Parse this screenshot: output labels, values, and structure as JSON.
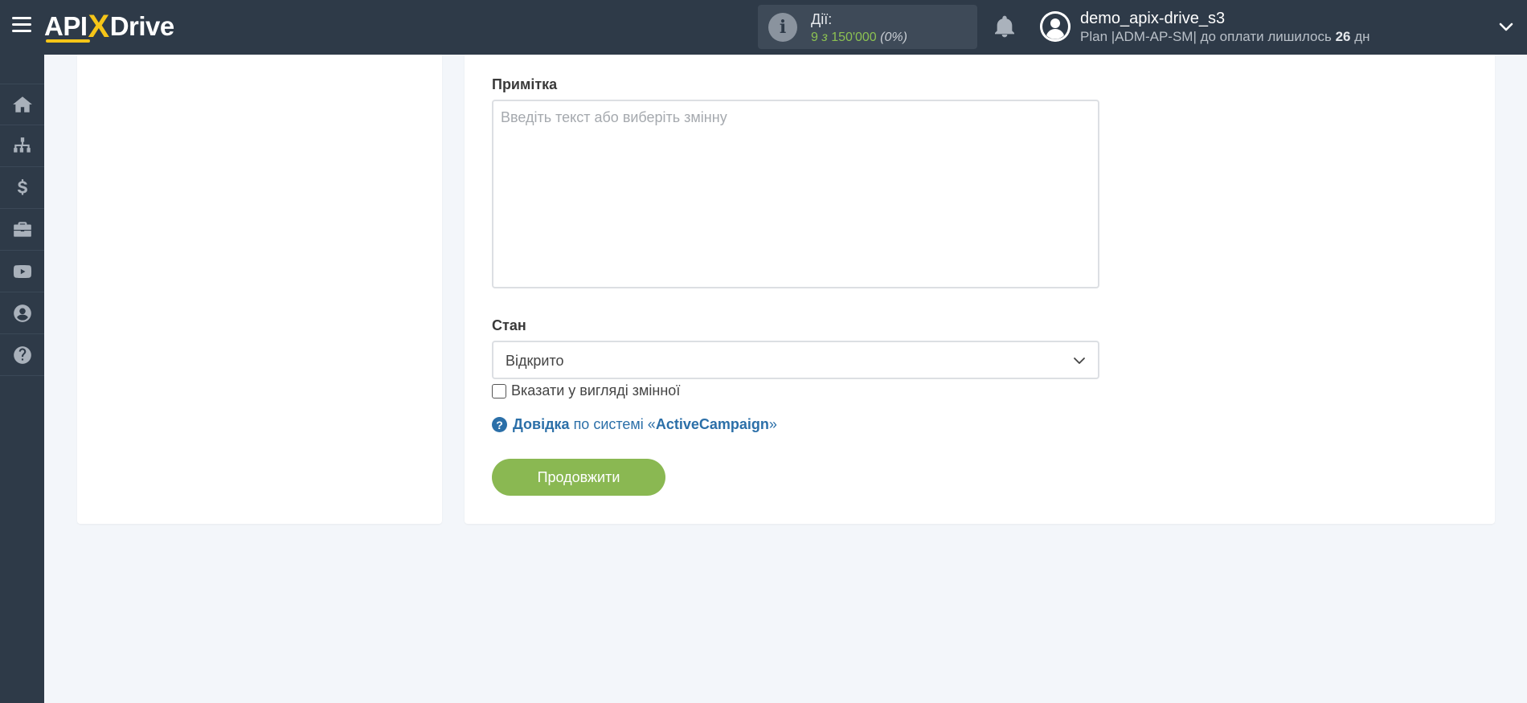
{
  "header": {
    "logo_api": "API",
    "logo_x": "X",
    "logo_drive": "Drive",
    "actions_label": "Дії:",
    "actions_used": "9",
    "actions_of": "з",
    "actions_limit": "150'000",
    "actions_percent": "(0%)",
    "user_name": "demo_apix-drive_s3",
    "plan_prefix": "Plan |ADM-AP-SM| до оплати лишилось",
    "plan_days": "26",
    "plan_suffix": "дн"
  },
  "sidebar": {
    "items": [
      {
        "icon": "home-icon"
      },
      {
        "icon": "sitemap-icon"
      },
      {
        "icon": "dollar-icon"
      },
      {
        "icon": "briefcase-icon"
      },
      {
        "icon": "youtube-icon"
      },
      {
        "icon": "user-circle-icon"
      },
      {
        "icon": "question-circle-icon"
      }
    ]
  },
  "form": {
    "note_label": "Примітка",
    "note_placeholder": "Введіть текст або виберіть змінну",
    "status_label": "Стан",
    "status_value": "Відкрито",
    "as_variable_label": "Вказати у вигляді змінної",
    "help_strong": "Довідка",
    "help_text": "по системі «",
    "help_link": "ActiveCampaign",
    "help_close": "»",
    "continue_button": "Продовжити"
  },
  "colors": {
    "topbar": "#2e3a48",
    "accent_green": "#8ab852",
    "link_blue": "#2b6fa8",
    "logo_yellow": "#f5c518"
  }
}
